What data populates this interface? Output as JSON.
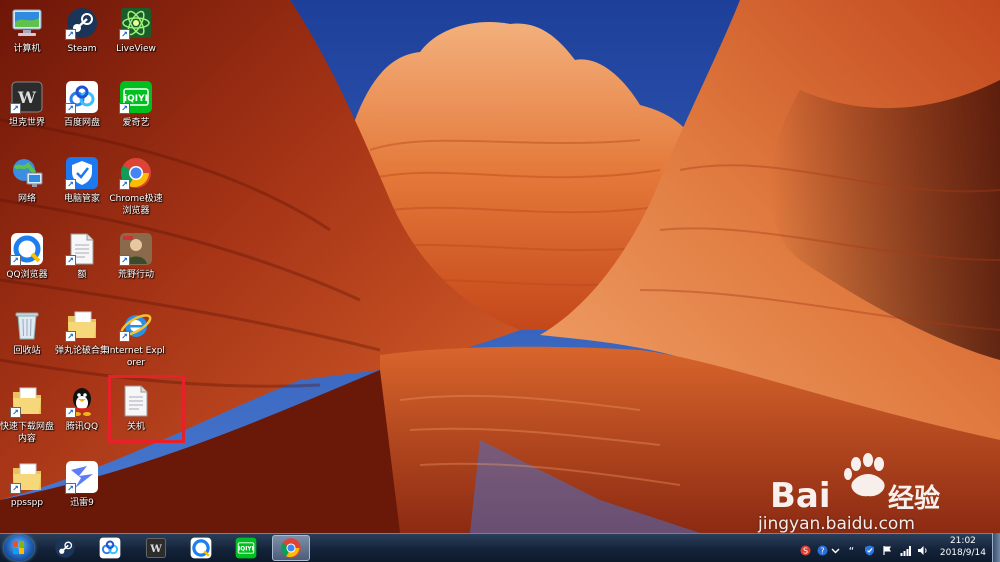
{
  "desktop": {
    "icons": [
      {
        "label": "计算机",
        "icon": "computer-icon"
      },
      {
        "label": "Steam",
        "icon": "steam-icon"
      },
      {
        "label": "LiveView",
        "icon": "liveview-icon"
      },
      {
        "label": "坦克世界",
        "icon": "world-of-tanks-icon"
      },
      {
        "label": "百度网盘",
        "icon": "baidu-netdisk-icon"
      },
      {
        "label": "爱奇艺",
        "icon": "iqiyi-icon"
      },
      {
        "label": "网络",
        "icon": "network-icon"
      },
      {
        "label": "电脑管家",
        "icon": "pc-manager-icon"
      },
      {
        "label": "Chrome极速浏览器",
        "icon": "chrome-icon"
      },
      {
        "label": "QQ浏览器",
        "icon": "qq-browser-icon"
      },
      {
        "label": "额",
        "icon": "text-file-icon"
      },
      {
        "label": "荒野行动",
        "icon": "knives-out-icon"
      },
      {
        "label": "回收站",
        "icon": "recycle-bin-icon"
      },
      {
        "label": "弹丸论破合集",
        "icon": "folder-icon"
      },
      {
        "label": "Internet Explorer",
        "icon": "internet-explorer-icon"
      },
      {
        "label": "快速下载网盘内容",
        "icon": "folder-icon"
      },
      {
        "label": "腾讯QQ",
        "icon": "qq-icon"
      },
      {
        "label": "关机",
        "icon": "text-file-icon"
      },
      {
        "label": "ppsspp",
        "icon": "folder-icon"
      },
      {
        "label": "迅雷9",
        "icon": "thunder-icon"
      }
    ],
    "selected_icon": "关机"
  },
  "taskbar": {
    "pinned": [
      "steam-icon",
      "baidu-netdisk-icon",
      "world-of-tanks-icon",
      "qq-browser-icon",
      "iqiyi-icon",
      "chrome-icon"
    ],
    "active": "chrome-icon",
    "clock": {
      "time": "21:02",
      "date": "2018/9/14"
    }
  },
  "watermark": {
    "brand": "Bai",
    "brand_cn": "经验",
    "url": "jingyan.baidu.com"
  },
  "colors": {
    "selection": "#e8202a",
    "taskbar": "#14233a"
  }
}
